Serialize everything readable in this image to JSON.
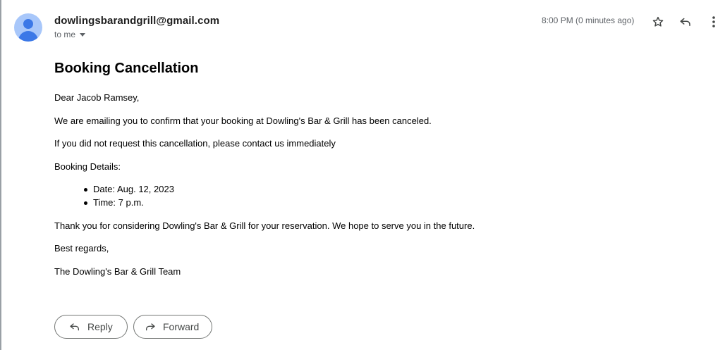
{
  "message": {
    "sender": "dowlingsbarandgrill@gmail.com",
    "recipient_label": "to me",
    "timestamp": "8:00 PM (0 minutes ago)",
    "subject": "Booking Cancellation",
    "body": {
      "greeting": "Dear Jacob Ramsey,",
      "line1": "We are emailing you to confirm that your booking at Dowling's Bar & Grill has been canceled.",
      "line2": "If you did not request this cancellation, please contact us immediately",
      "details_heading": "Booking Details:",
      "details": [
        "Date: Aug. 12, 2023",
        "Time: 7 p.m."
      ],
      "closing_line": "Thank you for considering Dowling's Bar & Grill for your reservation. We hope to serve you in the future.",
      "sign_off": "Best regards,",
      "signature": "The Dowling's Bar & Grill Team"
    }
  },
  "header_icons": {
    "star": "star-icon",
    "reply": "reply-icon",
    "more": "more-vert-icon",
    "caret": "chevron-down-icon"
  },
  "actions": {
    "reply_label": "Reply",
    "forward_label": "Forward"
  },
  "colors": {
    "avatar_bg": "#a8c7fa",
    "avatar_fg": "#3b78e7",
    "muted_text": "#5f6368",
    "button_border": "#747775"
  }
}
